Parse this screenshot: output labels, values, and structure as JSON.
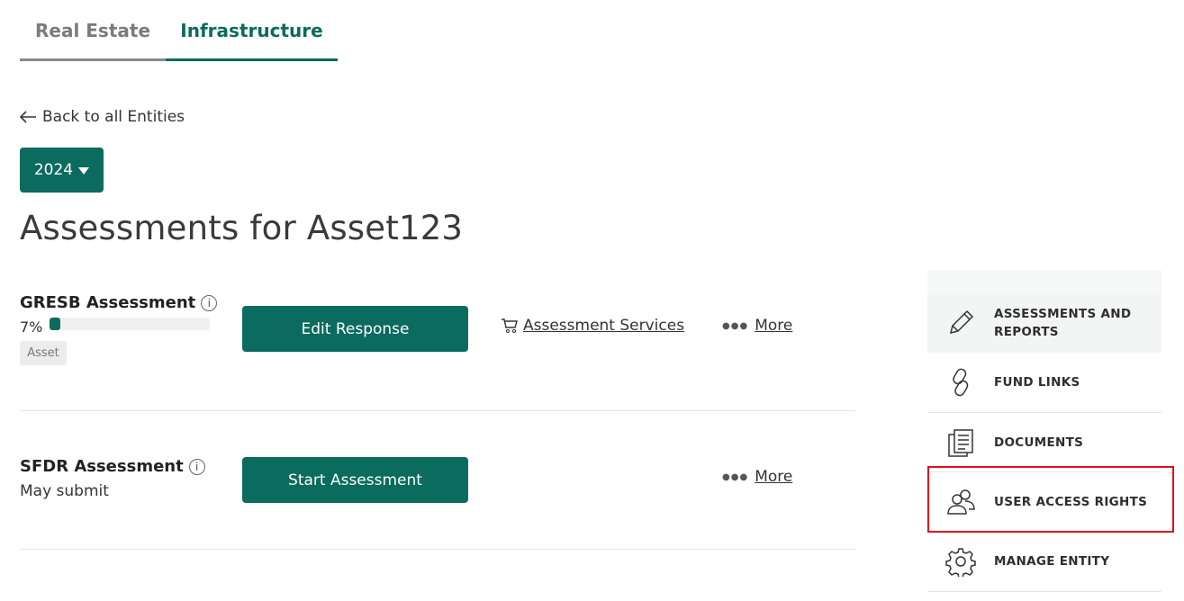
{
  "tabs": [
    {
      "label": "Real Estate",
      "active": false
    },
    {
      "label": "Infrastructure",
      "active": true
    }
  ],
  "back_link": "Back to all Entities",
  "year_selector": {
    "value": "2024"
  },
  "page_title": "Assessments for Asset123",
  "assessments": [
    {
      "name": "GRESB Assessment",
      "progress_label": "7%",
      "progress_value": 7,
      "badge": "Asset",
      "primary_action": "Edit Response",
      "services_link": "Assessment Services",
      "more_link": "More"
    },
    {
      "name": "SFDR Assessment",
      "status": "May submit",
      "primary_action": "Start Assessment",
      "more_link": "More"
    }
  ],
  "side_nav": {
    "items": [
      {
        "label_line1": "ASSESSMENTS AND",
        "label_line2": "REPORTS",
        "icon": "pencil-icon",
        "active": true
      },
      {
        "label": "FUND LINKS",
        "icon": "link-icon"
      },
      {
        "label": "DOCUMENTS",
        "icon": "documents-icon"
      },
      {
        "label": "USER ACCESS RIGHTS",
        "icon": "users-icon",
        "highlighted": true
      },
      {
        "label": "MANAGE ENTITY",
        "icon": "gear-icon"
      }
    ]
  },
  "colors": {
    "brand": "#0a6b5e",
    "highlight": "#e0101a"
  }
}
